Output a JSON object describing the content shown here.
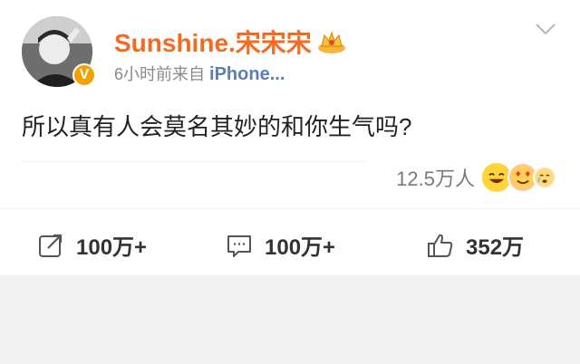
{
  "post": {
    "username": "Sunshine.宋宋宋",
    "time": "6小时前",
    "via": "来自",
    "device": "iPhone...",
    "text": "所以真有人会莫名其妙的和你生气吗?",
    "readers": "12.5万人"
  },
  "actions": {
    "share_count": "100万+",
    "comment_count": "100万+",
    "like_count": "352万"
  },
  "icons": {
    "avatar": "user-avatar",
    "verified": "verified-v-badge",
    "crown": "crown-icon",
    "more": "chevron-down-icon",
    "share": "share-icon",
    "comment": "comment-icon",
    "like": "thumbs-up-icon",
    "reactions": [
      "laughing-emoji-icon",
      "heart-eyes-emoji-icon",
      "crying-emoji-icon"
    ]
  },
  "colors": {
    "username": "#f26b21",
    "device": "#5a7fb5",
    "meta": "#8a8a8a",
    "badge": "#f2a200"
  }
}
